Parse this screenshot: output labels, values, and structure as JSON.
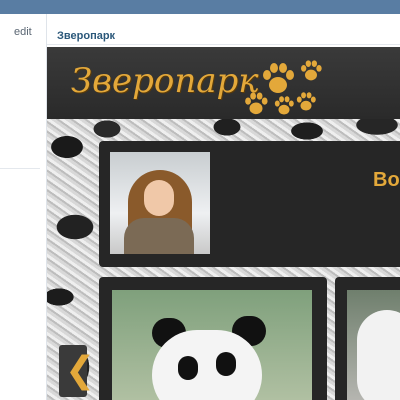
{
  "left_column": {
    "edit_label": "edit"
  },
  "page": {
    "title": "Зверопарк"
  },
  "banner": {
    "title": "Зверопарк"
  },
  "profile": {
    "name_partial": "Во"
  },
  "carousel": {
    "prev_icon": "❮"
  },
  "colors": {
    "accent": "#e3a83a",
    "topbar": "#597da3",
    "link": "#2b587a"
  }
}
